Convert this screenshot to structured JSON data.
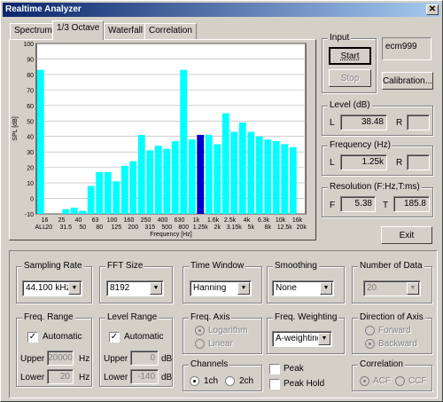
{
  "window": {
    "title": "Realtime Analyzer",
    "close_glyph": "✕"
  },
  "tabs": [
    "Spectrum",
    "1/3 Octave",
    "Waterfall",
    "Correlation"
  ],
  "input": {
    "label": "Input",
    "start": "Start",
    "stop": "Stop",
    "device": "ecm999",
    "calibration": "Calibration..."
  },
  "level": {
    "label": "Level (dB)",
    "l_label": "L",
    "l_value": "38.48",
    "r_label": "R",
    "r_value": ""
  },
  "frequency": {
    "label": "Frequency (Hz)",
    "l_label": "L",
    "l_value": "1.25k",
    "r_label": "R",
    "r_value": ""
  },
  "resolution": {
    "label": "Resolution (F:Hz,T:ms)",
    "f_label": "F",
    "f_value": "5.38",
    "t_label": "T",
    "t_value": "185.8"
  },
  "exit": "Exit",
  "sampling": {
    "label": "Sampling Rate",
    "value": "44.100 kHz"
  },
  "fft": {
    "label": "FFT Size",
    "value": "8192"
  },
  "window_fn": {
    "label": "Time Window",
    "value": "Hanning"
  },
  "smoothing": {
    "label": "Smoothing",
    "value": "None"
  },
  "ndata": {
    "label": "Number of Data",
    "value": "20"
  },
  "freq_range": {
    "label": "Freq. Range",
    "auto": "Automatic",
    "upper_label": "Upper",
    "upper": "20000",
    "upper_unit": "Hz",
    "lower_label": "Lower",
    "lower": "20",
    "lower_unit": "Hz"
  },
  "level_range": {
    "label": "Level Range",
    "auto": "Automatic",
    "upper_label": "Upper",
    "upper": "0",
    "upper_unit": "dB",
    "lower_label": "Lower",
    "lower": "-140",
    "lower_unit": "dB"
  },
  "freq_axis": {
    "label": "Freq. Axis",
    "log": "Logarithm",
    "lin": "Linear"
  },
  "freq_weight": {
    "label": "Freq. Weighting",
    "value": "A-weighting"
  },
  "direction": {
    "label": "Direction of Axis",
    "fwd": "Forward",
    "bwd": "Backward"
  },
  "channels": {
    "label": "Channels",
    "ch1": "1ch",
    "ch2": "2ch"
  },
  "peak": "Peak",
  "peak_hold": "Peak Hold",
  "correlation": {
    "label": "Correlation",
    "acf": "ACF",
    "ccf": "CCF"
  },
  "chart_data": {
    "type": "bar",
    "ylabel": "SPL [dB]",
    "xlabel": "Frequency [Hz]",
    "ylim": [
      -10,
      100
    ],
    "yticks": [
      100,
      90,
      80,
      70,
      60,
      50,
      40,
      30,
      20,
      10,
      0,
      -10
    ],
    "categories": [
      "ALL",
      "20",
      "25",
      "31.5",
      "40",
      "50",
      "63",
      "80",
      "100",
      "125",
      "160",
      "200",
      "250",
      "315",
      "400",
      "500",
      "630",
      "800",
      "1k",
      "1.25k",
      "1.6k",
      "2k",
      "2.5k",
      "3.15k",
      "4k",
      "5k",
      "6.3k",
      "8k",
      "10k",
      "12.5k",
      "16k",
      "20k"
    ],
    "x_top_labels": [
      "16",
      "25",
      "40",
      "63",
      "100",
      "160",
      "250",
      "400",
      "630",
      "1k",
      "1.6k",
      "2.5k",
      "4k",
      "6.3k",
      "10k",
      "16k"
    ],
    "x_bottom_labels": [
      "ALL",
      "20",
      "31.5",
      "50",
      "80",
      "125",
      "200",
      "315",
      "500",
      "800",
      "1.25k",
      "2k",
      "3.15k",
      "5k",
      "8k",
      "12.5k",
      "20k"
    ],
    "values": [
      83,
      -10,
      -10,
      -7,
      -6,
      -8,
      8,
      17,
      17,
      11,
      21,
      24,
      41,
      31,
      34,
      32,
      37,
      83,
      38,
      41,
      41,
      35,
      55,
      43,
      49,
      43,
      40,
      38,
      37,
      35,
      33,
      -10
    ],
    "highlight_index": 19,
    "bar_color": "#00ffff",
    "highlight_color": "#0000cc"
  }
}
